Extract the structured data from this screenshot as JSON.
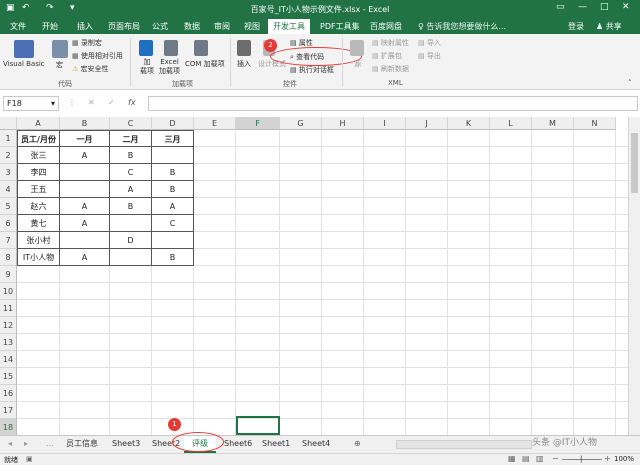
{
  "window": {
    "title": "百家号_IT小人物示例文件.xlsx - Excel"
  },
  "titlebar_controls": {
    "undo": "↶",
    "redo": "↷",
    "save": "▢",
    "help": "▢",
    "minimize": "—",
    "maximize": "□",
    "close": "✕"
  },
  "tabs": [
    "文件",
    "开始",
    "插入",
    "页面布局",
    "公式",
    "数据",
    "审阅",
    "视图",
    "开发工具",
    "PDF工具集",
    "百度网盘"
  ],
  "active_tab": "开发工具",
  "tell_me": "告诉我您想要做什么...",
  "user": "登录",
  "share": "共享",
  "ribbon": {
    "code": {
      "vb": "Visual Basic",
      "macro": "宏",
      "record": "录制宏",
      "relative": "使用相对引用",
      "security": "宏安全性",
      "group": "代码"
    },
    "addins": {
      "addin": "加\n载项",
      "excel": "Excel\n加载项",
      "com": "COM 加载项",
      "group": "加载项"
    },
    "controls": {
      "insert": "插入",
      "design": "设计模式",
      "properties": "属性",
      "view_code": "查看代码",
      "run_dialog": "执行对话框",
      "group": "控件"
    },
    "xml": {
      "source": "源",
      "map_props": "映射属性",
      "expand": "扩展包",
      "refresh": "刷新数据",
      "import": "导入",
      "export": "导出",
      "group": "XML"
    }
  },
  "namebox": "F18",
  "fx": "fx",
  "columns": [
    "A",
    "B",
    "C",
    "D",
    "E",
    "F",
    "G",
    "H",
    "I",
    "J",
    "K",
    "L",
    "M",
    "N"
  ],
  "rows": [
    "1",
    "2",
    "3",
    "4",
    "5",
    "6",
    "7",
    "8",
    "9",
    "10",
    "11",
    "12",
    "13",
    "14",
    "15",
    "16",
    "17",
    "18"
  ],
  "table": {
    "header": [
      "员工/月份",
      "一月",
      "二月",
      "三月"
    ],
    "rows": [
      [
        "张三",
        "A",
        "B",
        ""
      ],
      [
        "李四",
        "",
        "C",
        "B"
      ],
      [
        "王五",
        "",
        "A",
        "B"
      ],
      [
        "赵六",
        "A",
        "B",
        "A"
      ],
      [
        "黄七",
        "A",
        "",
        "C"
      ],
      [
        "张小村",
        "",
        "D",
        ""
      ],
      [
        "IT小人物",
        "A",
        "",
        "B"
      ]
    ]
  },
  "sheets": [
    "员工信息",
    "Sheet3",
    "Sheet2",
    "评级",
    "Sheet6",
    "Sheet1",
    "Sheet4"
  ],
  "active_sheet": "评级",
  "annotations": [
    "1",
    "2"
  ],
  "status": {
    "ready": "就绪",
    "zoom": "100%"
  },
  "watermark": "头条 @IT小人物",
  "colors": {
    "excel_green": "#217346",
    "highlight": "#e53935"
  }
}
